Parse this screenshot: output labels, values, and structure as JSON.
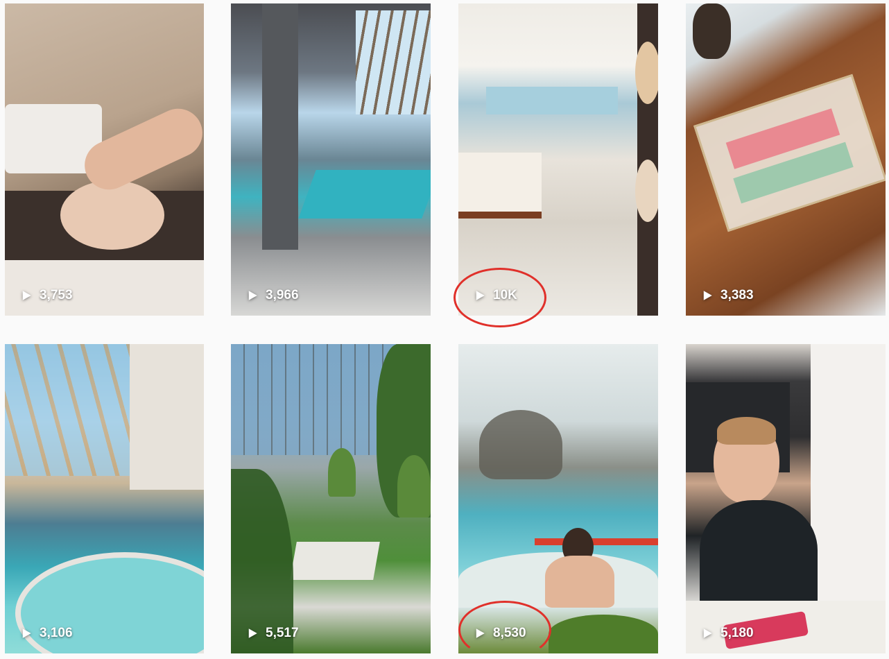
{
  "reels": [
    {
      "views": "3,753",
      "scene": "facial massage",
      "highlighted": false
    },
    {
      "views": "3,966",
      "scene": "indoor pool with glass roof",
      "highlighted": false
    },
    {
      "views": "10K",
      "scene": "spa reception through glass door",
      "highlighted": true
    },
    {
      "views": "3,383",
      "scene": "soaps on wooden tray",
      "highlighted": false
    },
    {
      "views": "3,106",
      "scene": "indoor pool and jacuzzi",
      "highlighted": false
    },
    {
      "views": "5,517",
      "scene": "courtyard with lawn and planters",
      "highlighted": false
    },
    {
      "views": "8,530",
      "scene": "woman in jacuzzi",
      "highlighted": true
    },
    {
      "views": "5,180",
      "scene": "smiling staff member at table",
      "highlighted": false
    }
  ],
  "icons": {
    "play": "play-icon"
  },
  "colors": {
    "highlight": "#e0302a",
    "background": "#fafafa"
  }
}
